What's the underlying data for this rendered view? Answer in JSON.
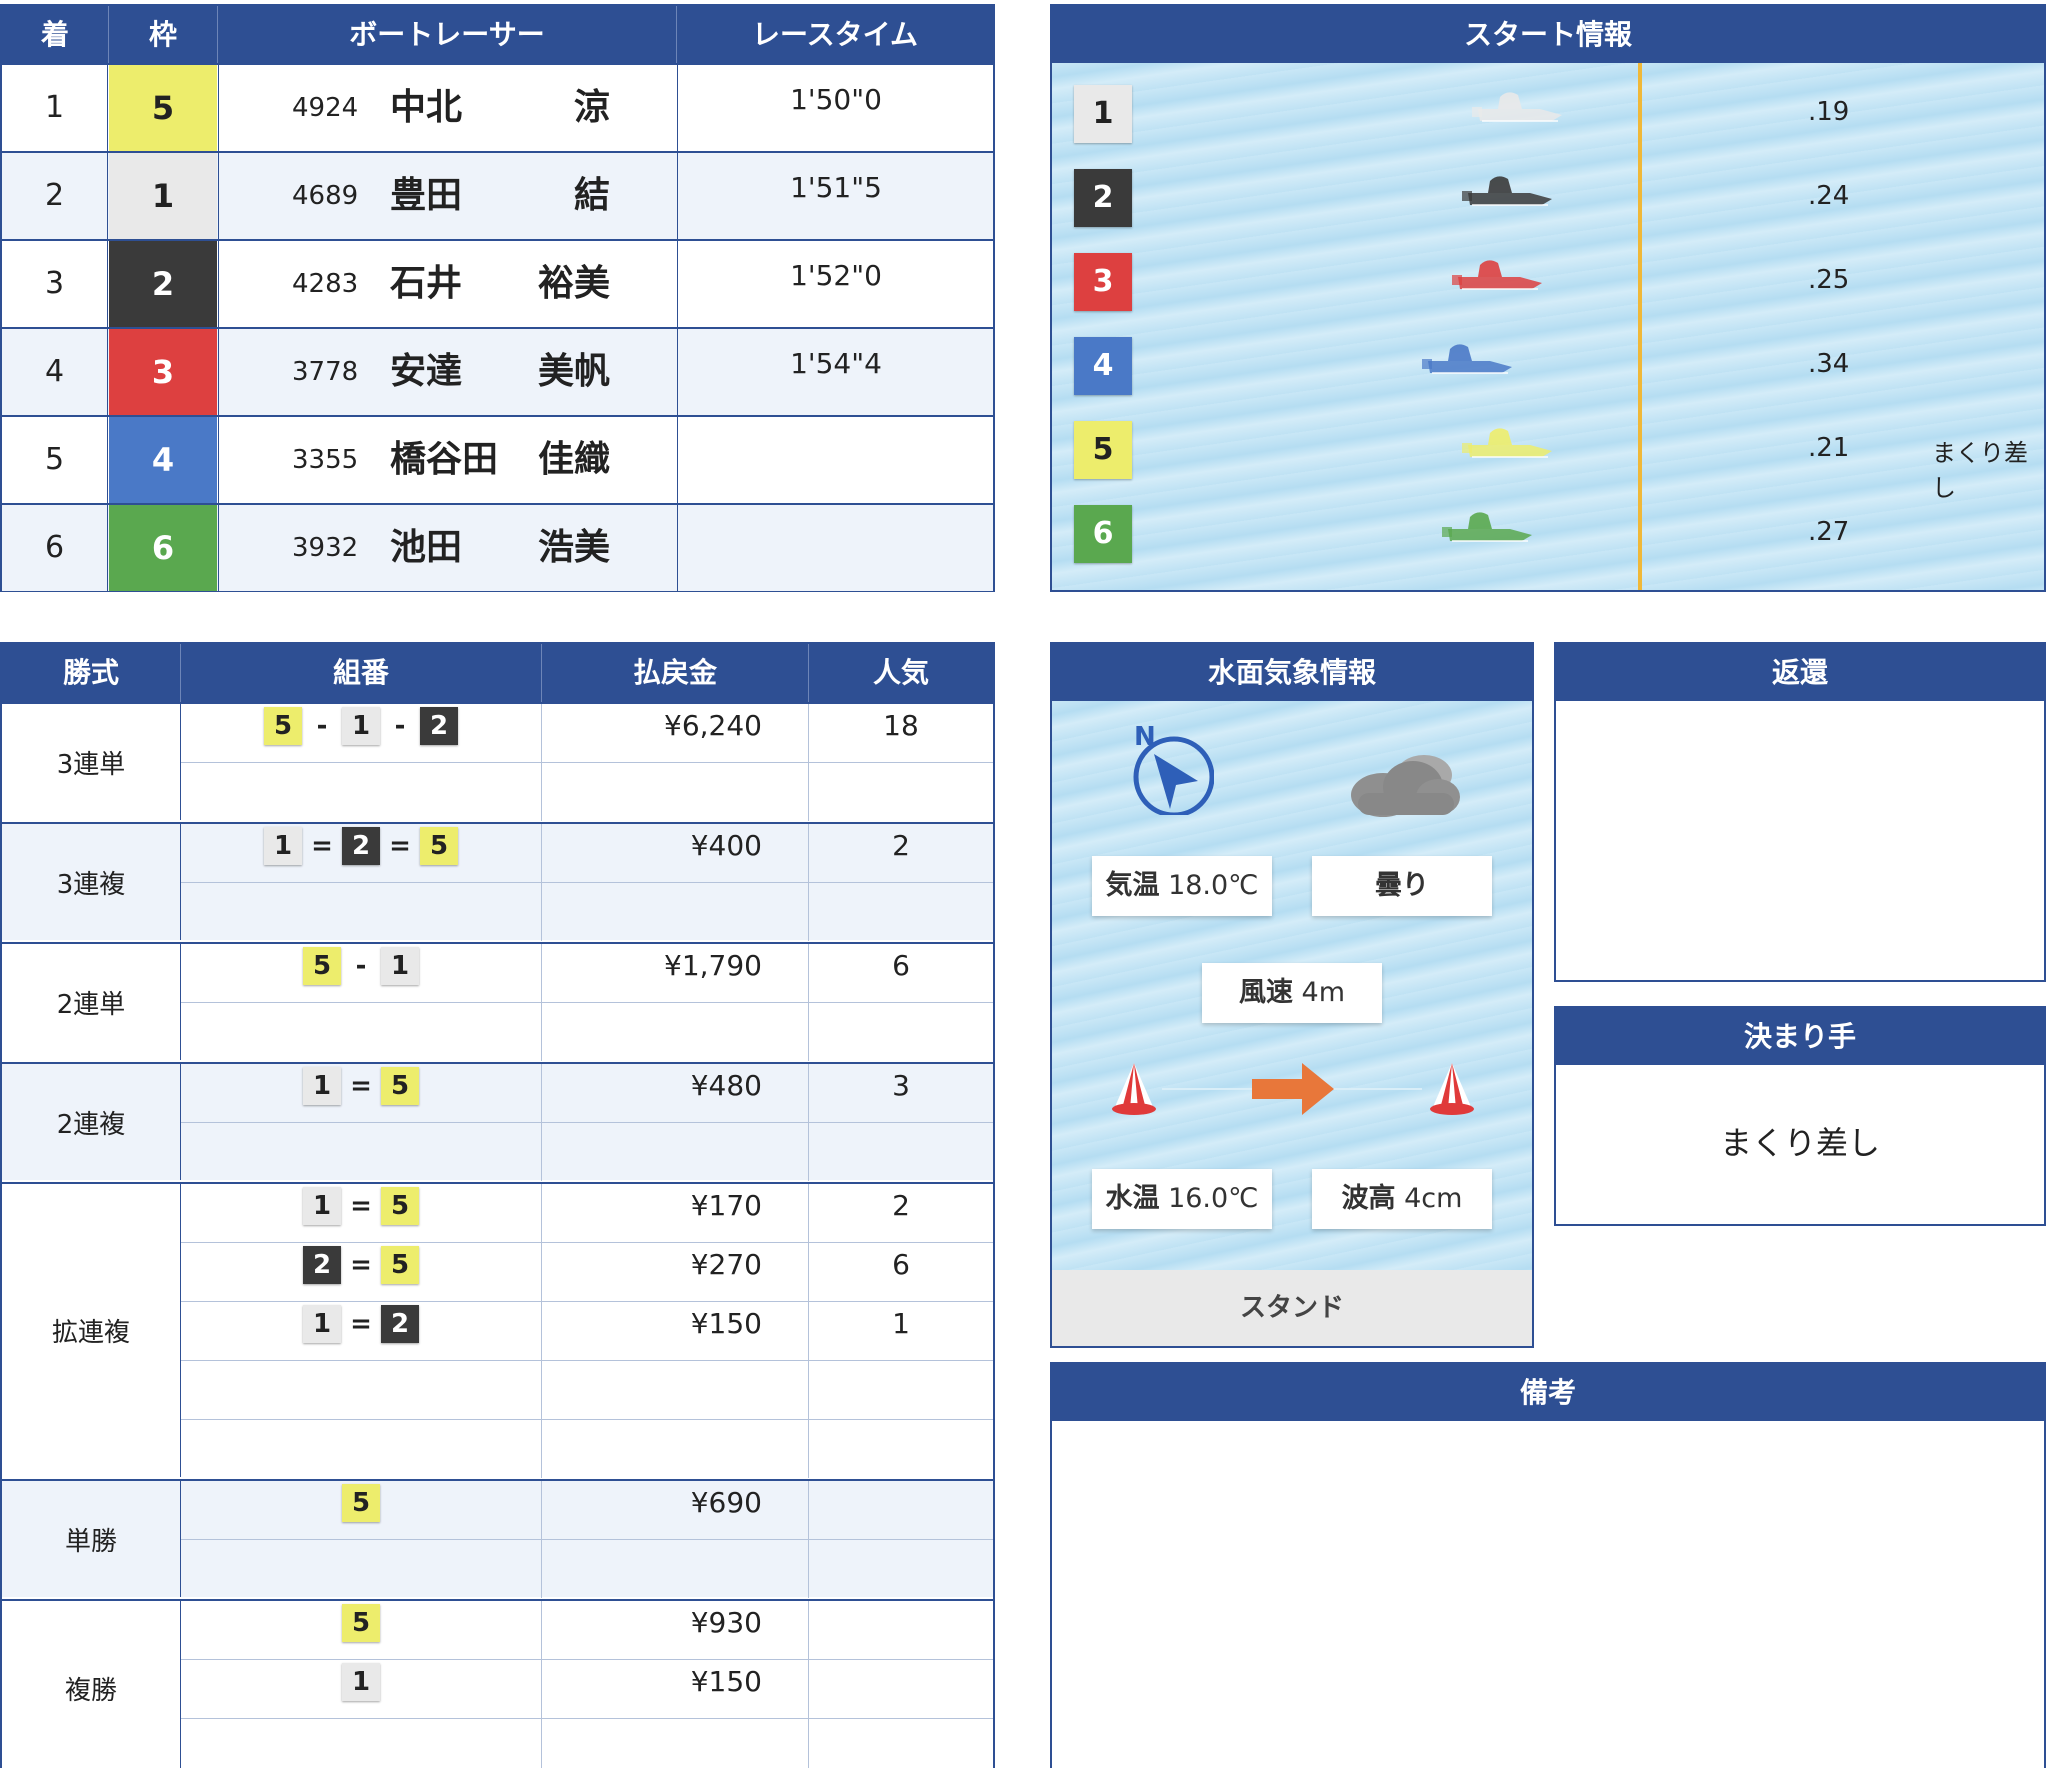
{
  "results": {
    "headers": {
      "pos": "着",
      "waku": "枠",
      "racer": "ボートレーサー",
      "time": "レースタイム"
    },
    "rows": [
      {
        "pos": "1",
        "waku": "5",
        "id": "4924",
        "last": "中北",
        "first": "涼",
        "time": "1'50\"0"
      },
      {
        "pos": "2",
        "waku": "1",
        "id": "4689",
        "last": "豊田",
        "first": "結",
        "time": "1'51\"5"
      },
      {
        "pos": "3",
        "waku": "2",
        "id": "4283",
        "last": "石井",
        "first": "裕美",
        "time": "1'52\"0"
      },
      {
        "pos": "4",
        "waku": "3",
        "id": "3778",
        "last": "安達",
        "first": "美帆",
        "time": "1'54\"4"
      },
      {
        "pos": "5",
        "waku": "4",
        "id": "3355",
        "last": "橋谷田",
        "first": "佳織",
        "time": ""
      },
      {
        "pos": "6",
        "waku": "6",
        "id": "3932",
        "last": "池田",
        "first": "浩美",
        "time": ""
      }
    ]
  },
  "start_info": {
    "title": "スタート情報",
    "lanes": [
      {
        "lane": "1",
        "st": ".19",
        "tech": "",
        "color": "#e9e9e9"
      },
      {
        "lane": "2",
        "st": ".24",
        "tech": "",
        "color": "#3a3a3a"
      },
      {
        "lane": "3",
        "st": ".25",
        "tech": "",
        "color": "#dd4040"
      },
      {
        "lane": "4",
        "st": ".34",
        "tech": "",
        "color": "#4a79c7"
      },
      {
        "lane": "5",
        "st": ".21",
        "tech": "まくり差し",
        "color": "#eded6c"
      },
      {
        "lane": "6",
        "st": ".27",
        "tech": "",
        "color": "#5aa84f"
      }
    ]
  },
  "payout": {
    "headers": {
      "type": "勝式",
      "combo": "組番",
      "amount": "払戻金",
      "pop": "人気"
    },
    "groups": [
      {
        "name": "3連単",
        "rows": [
          {
            "nums": [
              "5",
              "1",
              "2"
            ],
            "sep": "-",
            "amount": "¥6,240",
            "pop": "18"
          },
          {
            "nums": [],
            "sep": "",
            "amount": "",
            "pop": ""
          }
        ]
      },
      {
        "name": "3連複",
        "rows": [
          {
            "nums": [
              "1",
              "2",
              "5"
            ],
            "sep": "=",
            "amount": "¥400",
            "pop": "2"
          },
          {
            "nums": [],
            "sep": "",
            "amount": "",
            "pop": ""
          }
        ]
      },
      {
        "name": "2連単",
        "rows": [
          {
            "nums": [
              "5",
              "1"
            ],
            "sep": "-",
            "amount": "¥1,790",
            "pop": "6"
          },
          {
            "nums": [],
            "sep": "",
            "amount": "",
            "pop": ""
          }
        ]
      },
      {
        "name": "2連複",
        "rows": [
          {
            "nums": [
              "1",
              "5"
            ],
            "sep": "=",
            "amount": "¥480",
            "pop": "3"
          },
          {
            "nums": [],
            "sep": "",
            "amount": "",
            "pop": ""
          }
        ]
      },
      {
        "name": "拡連複",
        "rows": [
          {
            "nums": [
              "1",
              "5"
            ],
            "sep": "=",
            "amount": "¥170",
            "pop": "2"
          },
          {
            "nums": [
              "2",
              "5"
            ],
            "sep": "=",
            "amount": "¥270",
            "pop": "6"
          },
          {
            "nums": [
              "1",
              "2"
            ],
            "sep": "=",
            "amount": "¥150",
            "pop": "1"
          },
          {
            "nums": [],
            "sep": "",
            "amount": "",
            "pop": ""
          },
          {
            "nums": [],
            "sep": "",
            "amount": "",
            "pop": ""
          }
        ]
      },
      {
        "name": "単勝",
        "rows": [
          {
            "nums": [
              "5"
            ],
            "sep": "",
            "amount": "¥690",
            "pop": ""
          },
          {
            "nums": [],
            "sep": "",
            "amount": "",
            "pop": ""
          }
        ]
      },
      {
        "name": "複勝",
        "rows": [
          {
            "nums": [
              "5"
            ],
            "sep": "",
            "amount": "¥930",
            "pop": ""
          },
          {
            "nums": [
              "1"
            ],
            "sep": "",
            "amount": "¥150",
            "pop": ""
          },
          {
            "nums": [],
            "sep": "",
            "amount": "",
            "pop": ""
          }
        ]
      }
    ]
  },
  "weather": {
    "title": "水面気象情報",
    "compass_label": "N",
    "temp_label": "気温",
    "temp_value": "18.0℃",
    "condition": "曇り",
    "wind_label": "風速",
    "wind_value": "4m",
    "water_temp_label": "水温",
    "water_temp_value": "16.0℃",
    "wave_label": "波高",
    "wave_value": "4cm",
    "stand": "スタンド",
    "icons": [
      "compass-icon",
      "cloud-icon",
      "buoy-icon",
      "wind-arrow-icon"
    ]
  },
  "refund": {
    "title": "返還",
    "value": ""
  },
  "kimarite": {
    "title": "決まり手",
    "value": "まくり差し"
  },
  "notes": {
    "title": "備考",
    "value": ""
  },
  "colors": {
    "header": "#2e4f93",
    "lane1": "#e9e9e9",
    "lane2": "#3a3a3a",
    "lane3": "#dd4040",
    "lane4": "#4a79c7",
    "lane5": "#eded6c",
    "lane6": "#5aa84f",
    "start_line": "#f0b838",
    "wind_arrow": "#e8773a"
  }
}
